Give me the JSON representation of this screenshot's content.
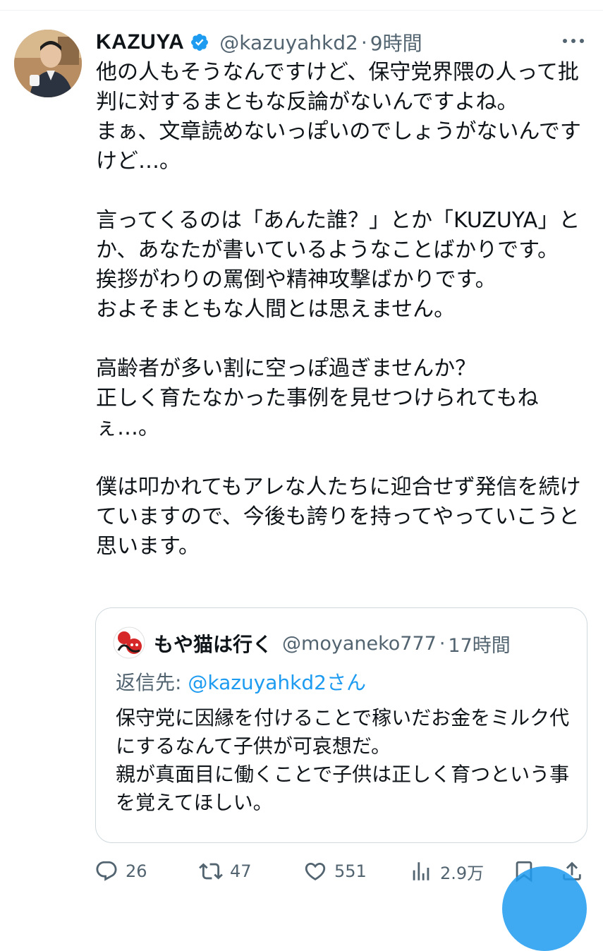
{
  "author": {
    "name": "KAZUYA",
    "handle": "@kazuyahkd2",
    "separator": "·",
    "time": "9時間"
  },
  "tweet_text": "他の人もそうなんですけど、保守党界隈の人って批判に対するまともな反論がないんですよね。\nまぁ、文章読めないっぽいのでしょうがないんですけど…。\n\n言ってくるのは「あんた誰？」とか「KUZUYA」とか、あなたが書いているようなことばかりです。\n挨拶がわりの罵倒や精神攻撃ばかりです。\nおよそまともな人間とは思えません。\n\n高齢者が多い割に空っぽ過ぎませんか？\n正しく育たなかった事例を見せつけられてもねぇ…。\n\n僕は叩かれてもアレな人たちに迎合せず発信を続けていますので、今後も誇りを持ってやっていこうと思います。",
  "quoted": {
    "name": "もや猫は行く",
    "handle": "@moyaneko777",
    "separator": "·",
    "time": "17時間",
    "reply_prefix": "返信先: ",
    "reply_mention": "@kazuyahkd2",
    "reply_suffix": "さん",
    "text": "保守党に因縁を付けることで稼いだお金をミルク代にするなんて子供が可哀想だ。\n親が真面目に働くことで子供は正しく育つという事を覚えてほしい。"
  },
  "actions": {
    "replies": "26",
    "retweets": "47",
    "likes": "551",
    "views": "2.9万"
  },
  "colors": {
    "accent": "#1d9bf0",
    "text": "#0f1419",
    "secondary": "#536471",
    "border": "#cfd9de"
  }
}
